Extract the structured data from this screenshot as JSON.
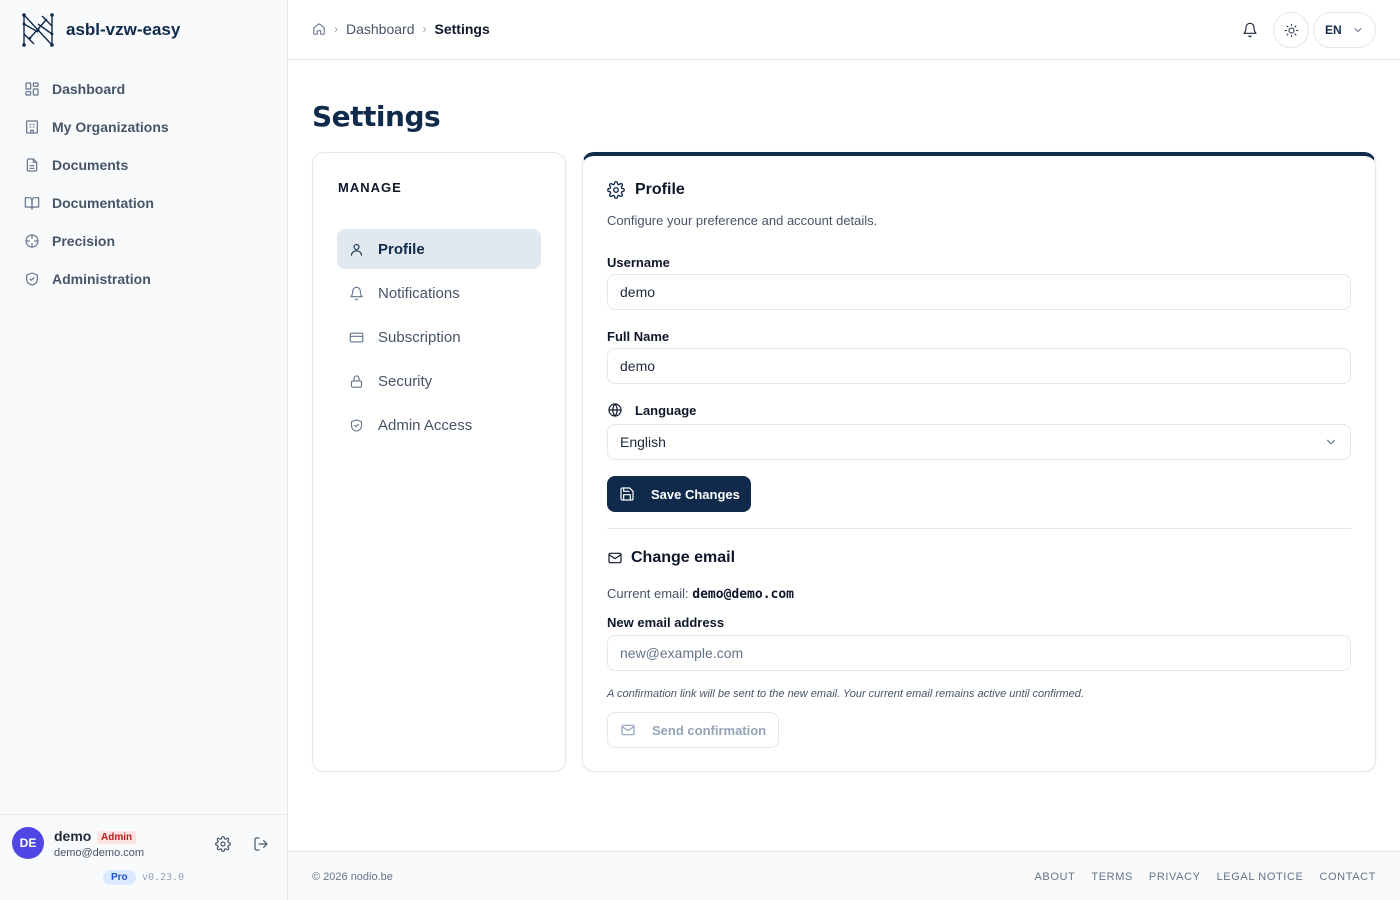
{
  "brand": {
    "name": "asbl-vzw-easy",
    "logo_icon": "network-n-logo"
  },
  "sidebar": {
    "items": [
      {
        "label": "Dashboard",
        "icon": "dashboard-icon"
      },
      {
        "label": "My Organizations",
        "icon": "building-icon"
      },
      {
        "label": "Documents",
        "icon": "document-icon"
      },
      {
        "label": "Documentation",
        "icon": "book-icon"
      },
      {
        "label": "Precision",
        "icon": "crosshair-icon"
      },
      {
        "label": "Administration",
        "icon": "shield-icon"
      }
    ]
  },
  "user": {
    "initials": "DE",
    "name": "demo",
    "role": "Admin",
    "email": "demo@demo.com",
    "plan": "Pro",
    "version": "v0.23.0"
  },
  "header": {
    "breadcrumb": [
      "Dashboard",
      "Settings"
    ],
    "language": "EN"
  },
  "page": {
    "title": "Settings"
  },
  "manage": {
    "title": "MANAGE",
    "items": [
      {
        "label": "Profile",
        "icon": "user-icon",
        "active": true
      },
      {
        "label": "Notifications",
        "icon": "bell-icon"
      },
      {
        "label": "Subscription",
        "icon": "credit-card-icon"
      },
      {
        "label": "Security",
        "icon": "lock-icon"
      },
      {
        "label": "Admin Access",
        "icon": "shield-check-icon"
      }
    ]
  },
  "profile": {
    "title": "Profile",
    "subtitle": "Configure your preference and account details.",
    "username_label": "Username",
    "username_value": "demo",
    "fullname_label": "Full Name",
    "fullname_value": "demo",
    "language_label": "Language",
    "language_value": "English",
    "save_label": "Save Changes"
  },
  "change_email": {
    "title": "Change email",
    "current_prefix": "Current email:",
    "current_value": "demo@demo.com",
    "new_label": "New email address",
    "new_placeholder": "new@example.com",
    "hint": "A confirmation link will be sent to the new email. Your current email remains active until confirmed.",
    "send_label": "Send confirmation"
  },
  "footer": {
    "copyright": "© 2026 nodio.be",
    "links": [
      "ABOUT",
      "TERMS",
      "PRIVACY",
      "LEGAL NOTICE",
      "CONTACT"
    ]
  },
  "colors": {
    "brand": "#0f2a4a",
    "avatar": "#4f46e5",
    "admin_badge": "#b91c1c",
    "pro_badge": "#1d4ed8"
  }
}
